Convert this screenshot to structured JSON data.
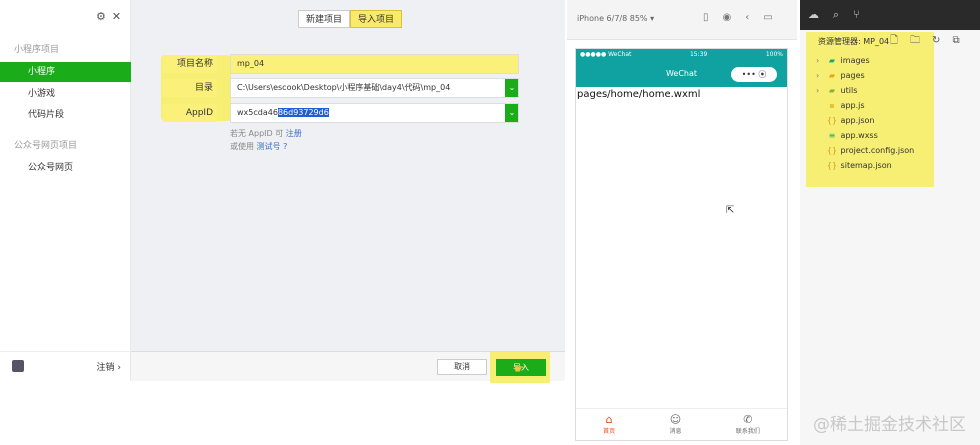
{
  "dialog": {
    "sidebar": {
      "groups": [
        {
          "title": "小程序项目",
          "items": [
            "小程序",
            "小游戏",
            "代码片段"
          ]
        },
        {
          "title": "公众号网页项目",
          "items": [
            "公众号网页"
          ]
        }
      ],
      "active_item": "小程序",
      "logout_label": "注销 ›"
    },
    "tabs": [
      "新建项目",
      "导入项目"
    ],
    "active_tab": "导入项目",
    "form": {
      "project_name_label": "项目名称",
      "project_name_value": "mp_04",
      "dir_label": "目录",
      "dir_value": "C:\\Users\\escook\\Desktop\\小程序基础\\day4\\代码\\mp_04",
      "appid_label": "AppID",
      "appid_value_plain": "wx5cda46",
      "appid_value_selected": "86d93729d6",
      "hint_line1_text": "若无 AppID 可",
      "hint_line1_link": "注册",
      "hint_line2_text": "或使用",
      "hint_line2_link": "测试号",
      "hint_line2_help": "?"
    },
    "buttons": {
      "cancel": "取消",
      "import": "导入"
    }
  },
  "simulator": {
    "device": "iPhone 6/7/8 85% ▾",
    "status_carrier": "●●●●● WeChat",
    "status_time": "15:39",
    "status_battery": "100%",
    "nav_title": "WeChat",
    "capsule": "••• ⦿",
    "page_path": "pages/home/home.wxml",
    "tabs": [
      {
        "icon": "⌂",
        "label": "首页"
      },
      {
        "icon": "☺",
        "label": "消息"
      },
      {
        "icon": "✆",
        "label": "联系我们"
      }
    ]
  },
  "explorer": {
    "title": "资源管理器: MP_04",
    "items": [
      {
        "name": "images",
        "type": "folder",
        "icon": "▰",
        "color": "#19a974"
      },
      {
        "name": "pages",
        "type": "folder",
        "icon": "▰",
        "color": "#e8a317"
      },
      {
        "name": "utils",
        "type": "folder",
        "icon": "▰",
        "color": "#7bb43a"
      },
      {
        "name": "app.js",
        "type": "file",
        "icon": "▪",
        "color": "#e8c22e"
      },
      {
        "name": "app.json",
        "type": "file",
        "icon": "{}",
        "color": "#d59b1f"
      },
      {
        "name": "app.wxss",
        "type": "file",
        "icon": "≡",
        "color": "#19a974"
      },
      {
        "name": "project.config.json",
        "type": "file",
        "icon": "{}",
        "color": "#d59b1f"
      },
      {
        "name": "sitemap.json",
        "type": "file",
        "icon": "{}",
        "color": "#d59b1f"
      }
    ]
  },
  "watermark": "@稀土掘金技术社区"
}
